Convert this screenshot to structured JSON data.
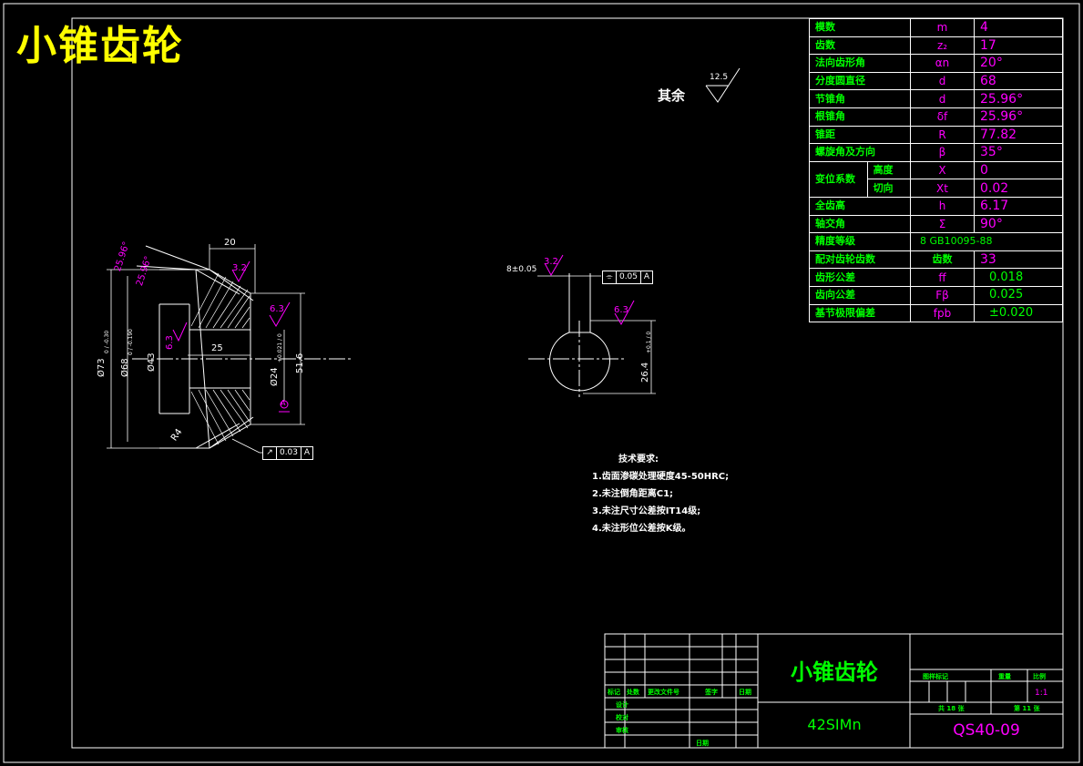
{
  "title": "小锥齿轮",
  "params": [
    {
      "name": "模数",
      "symbol": "m",
      "value": "4"
    },
    {
      "name": "齿数",
      "symbol": "z₂",
      "value": "17"
    },
    {
      "name": "法向齿形角",
      "symbol": "αn",
      "value": "20°"
    },
    {
      "name": "分度圆直径",
      "symbol": "d",
      "value": "68"
    },
    {
      "name": "节锥角",
      "symbol": "d",
      "value": "25.96°"
    },
    {
      "name": "根锥角",
      "symbol": "δf",
      "value": "25.96°"
    },
    {
      "name": "锥距",
      "symbol": "R",
      "value": "77.82"
    },
    {
      "name": "螺旋角及方向",
      "symbol": "β",
      "value": "35°"
    },
    {
      "name": "变位系数",
      "sub": "高度",
      "symbol": "X",
      "value": "0"
    },
    {
      "sub": "切向",
      "symbol": "Xt",
      "value": "0.02"
    },
    {
      "name": "全齿高",
      "symbol": "h",
      "value": "6.17"
    },
    {
      "name": "轴交角",
      "symbol": "Σ",
      "value": "90°"
    },
    {
      "name": "精度等级",
      "span_value": "8 GB10095-88"
    },
    {
      "name": "配对齿轮齿数",
      "symbol": "齿数",
      "value": "33"
    },
    {
      "name": "齿形公差",
      "symbol": "ff",
      "value": "0.018"
    },
    {
      "name": "齿向公差",
      "symbol": "Fβ",
      "value": "0.025"
    },
    {
      "name": "基节极限偏差",
      "symbol": "fpb",
      "value": "±0.020"
    }
  ],
  "roughness": {
    "label": "其余",
    "value": "12.5"
  },
  "left_view": {
    "dims": {
      "width_top": "20",
      "angle1": "25.96°",
      "angle2": "25.96°",
      "od": "Ø73",
      "od_tol": "0 / -0.30",
      "pitch": "Ø68",
      "pitch_tol": "0 / -0.190",
      "bore": "Ø43",
      "inner": "25",
      "shaft": "Ø24",
      "shaft_tol": "+0.021 / 0",
      "length": "51.6",
      "radius": "R4",
      "rough_a": "3.2",
      "rough_b": "6.3",
      "rough_c": "6.3"
    },
    "gdt": {
      "symbol": "↗",
      "tol": "0.03",
      "datum": "A"
    },
    "datum_label": "A"
  },
  "right_view": {
    "key_width": "8±0.05",
    "key_height": "26.4",
    "key_height_tol": "+0.1 / 0",
    "rough_a": "3.2",
    "rough_b": "6.3",
    "gdt": {
      "symbol": "⌯",
      "tol": "0.05",
      "datum": "A"
    }
  },
  "notes": {
    "heading": "技术要求:",
    "items": [
      "1.齿面渗碳处理硬度45-50HRC;",
      "2.未注倒角距离C1;",
      "3.未注尺寸公差按IT14级;",
      "4.未注形位公差按K级。"
    ]
  },
  "title_block": {
    "part_name": "小锥齿轮",
    "material": "42SIMn",
    "code": "QS40-09",
    "stage_label": "图样标记",
    "weight_label": "重量",
    "scale_label": "比例",
    "scale": "1:1",
    "total_sheets": "共 18 张",
    "sheet_no": "第 11 张",
    "rev_headers": [
      "标记",
      "处数",
      "更改文件号",
      "签字",
      "日期"
    ],
    "roles": [
      "设计",
      "校对",
      "审核"
    ],
    "date_label": "日期"
  },
  "colors": {
    "frame": "#ffffff",
    "text_primary": "#00ff00",
    "text_value": "#ff00ff",
    "title": "#ffff00",
    "hatch": "#ffffff",
    "center": "#ffffff"
  }
}
